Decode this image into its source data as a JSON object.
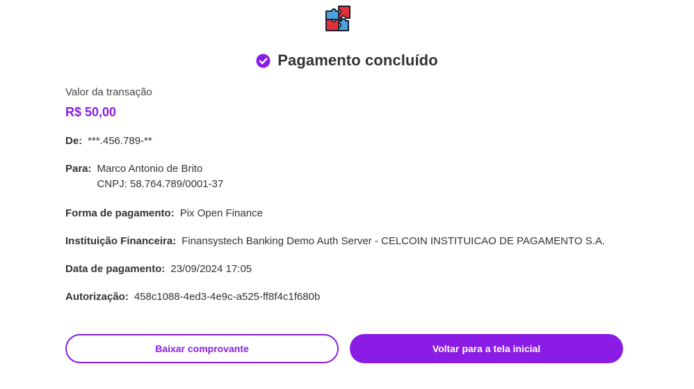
{
  "header": {
    "logo_icon": "puzzle-logo-icon",
    "status_icon": "check-circle-icon",
    "title": "Pagamento concluído"
  },
  "transaction": {
    "amount_label": "Valor da transação",
    "amount_value": "R$ 50,00",
    "from_label": "De:",
    "from_value": "***.456.789-**",
    "to_label": "Para:",
    "to_name": "Marco Antonio de Brito",
    "to_doc": "CNPJ: 58.764.789/0001-37",
    "method_label": "Forma de pagamento:",
    "method_value": "Pix Open Finance",
    "institution_label": "Instituição Financeira:",
    "institution_value": "Finansystech Banking Demo Auth Server - CELCOIN INSTITUICAO DE PAGAMENTO S.A.",
    "date_label": "Data de pagamento:",
    "date_value": "23/09/2024 17:05",
    "auth_label": "Autorização:",
    "auth_value": "458c1088-4ed3-4e9c-a525-ff8f4c1f680b"
  },
  "actions": {
    "download_label": "Baixar comprovante",
    "home_label": "Voltar para a tela inicial"
  },
  "colors": {
    "accent": "#8a1ce6",
    "text": "#333333"
  }
}
